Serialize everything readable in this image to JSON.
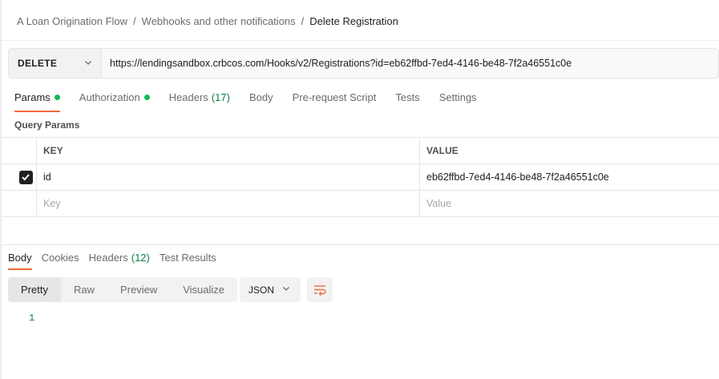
{
  "breadcrumb": {
    "items": [
      "A Loan Origination Flow",
      "Webhooks and other notifications"
    ],
    "separator": "/",
    "current": "Delete Registration"
  },
  "request": {
    "method": "DELETE",
    "url": "https://lendingsandbox.crbcos.com/Hooks/v2/Registrations?id=eb62ffbd-7ed4-4146-be48-7f2a46551c0e"
  },
  "request_tabs": {
    "params": "Params",
    "authorization": "Authorization",
    "headers": "Headers",
    "headers_count": "(17)",
    "body": "Body",
    "prerequest": "Pre-request Script",
    "tests": "Tests",
    "settings": "Settings"
  },
  "query_params": {
    "title": "Query Params",
    "columns": {
      "key": "KEY",
      "value": "VALUE"
    },
    "rows": [
      {
        "key": "id",
        "value": "eb62ffbd-7ed4-4146-be48-7f2a46551c0e",
        "checked": true
      }
    ],
    "placeholder": {
      "key": "Key",
      "value": "Value"
    }
  },
  "response_tabs": {
    "body": "Body",
    "cookies": "Cookies",
    "headers": "Headers",
    "headers_count": "(12)",
    "test_results": "Test Results"
  },
  "response_toolbar": {
    "views": [
      "Pretty",
      "Raw",
      "Preview",
      "Visualize"
    ],
    "active_view": "Pretty",
    "format": "JSON"
  },
  "response_body": {
    "line_number": "1"
  },
  "colors": {
    "accent": "#f26b3a",
    "status_dot": "#0cbb52",
    "count_text": "#0c7e3f"
  },
  "icons": {
    "method_dropdown": "chevron-down-icon",
    "checkbox": "check-icon",
    "format_dropdown": "chevron-down-icon",
    "wrap": "wrap-lines-icon"
  }
}
